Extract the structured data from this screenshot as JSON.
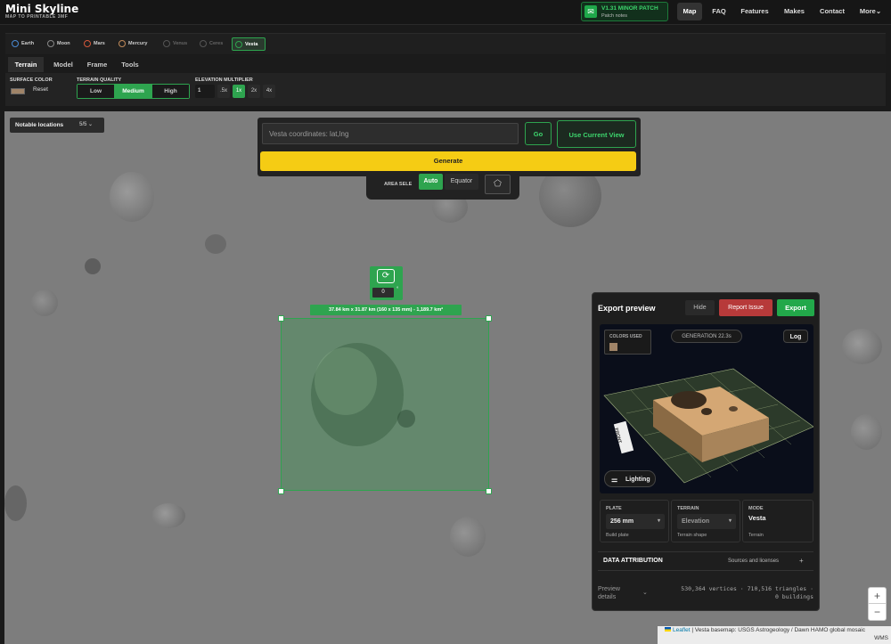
{
  "header": {
    "logo_title": "Mini Skyline",
    "logo_subtitle": "MAP TO PRINTABLE 3MF",
    "patch_title": "V1.31 MINOR PATCH",
    "patch_sub": "Patch notes",
    "nav": [
      "Map",
      "FAQ",
      "Features",
      "Makes",
      "Contact",
      "More"
    ],
    "active_nav": "Map"
  },
  "planets": [
    "Earth",
    "Moon",
    "Mars",
    "Mercury",
    "Venus",
    "Ceres",
    "Vesta"
  ],
  "active_planet": "Vesta",
  "tabs": [
    "Terrain",
    "Model",
    "Frame",
    "Tools"
  ],
  "active_tab": "Terrain",
  "settings": {
    "surface_color_label": "SURFACE COLOR",
    "surface_color": "#a08468",
    "reset_label": "Reset",
    "quality_label": "TERRAIN QUALITY",
    "quality_options": [
      "Low",
      "Medium",
      "High"
    ],
    "quality_selected": "Medium",
    "elevation_label": "ELEVATION MULTIPLIER",
    "elevation_value": "1",
    "elevation_options": [
      ".5x",
      "1x",
      "2x",
      "4x"
    ],
    "elevation_selected": "1x"
  },
  "map": {
    "notable_label": "Notable locations",
    "notable_count": "5/5",
    "search_placeholder": "Vesta coordinates: lat,lng",
    "go_label": "Go",
    "current_view_label": "Use Current View",
    "generate_label": "Generate",
    "area_select_label": "AREA SELE",
    "auto_label": "Auto",
    "equator_label": "Equator",
    "selection_dims": "37.84 km x 31.87 km (160 x 135 mm) - 1,189.7 km²",
    "rotation_value": "0",
    "rotation_unit": "°",
    "zoom_in": "+",
    "zoom_out": "−",
    "attribution_leaflet": "Leaflet",
    "attribution_text": "| Vesta basemap: USGS Astrogeology / Dawn HAMO global mosaic",
    "attribution_wms": "WMS"
  },
  "export": {
    "title": "Export preview",
    "hide_label": "Hide",
    "report_label": "Report Issue",
    "export_label": "Export",
    "colors_used_label": "COLORS USED",
    "generation_label": "GENERATION 22.3s",
    "log_label": "Log",
    "lighting_label": "Lighting",
    "front_label": "FRONT",
    "plate_label": "PLATE",
    "plate_value": "256 mm",
    "plate_foot": "Build plate",
    "terrain_label": "TERRAIN",
    "terrain_value": "Elevation",
    "terrain_foot": "Terrain shape",
    "mode_label": "MODE",
    "mode_value": "Vesta",
    "mode_foot": "Terrain",
    "attribution_label": "DATA ATTRIBUTION",
    "sources_label": "Sources and licenses",
    "preview_details_label": "Preview details",
    "stats_line1": "530,364 vertices · 710,516 triangles ·",
    "stats_line2": "0 buildings"
  },
  "colors": {
    "accent_green": "#2ea44f",
    "generate_yellow": "#f5cc14",
    "report_red": "#b73a3a"
  }
}
